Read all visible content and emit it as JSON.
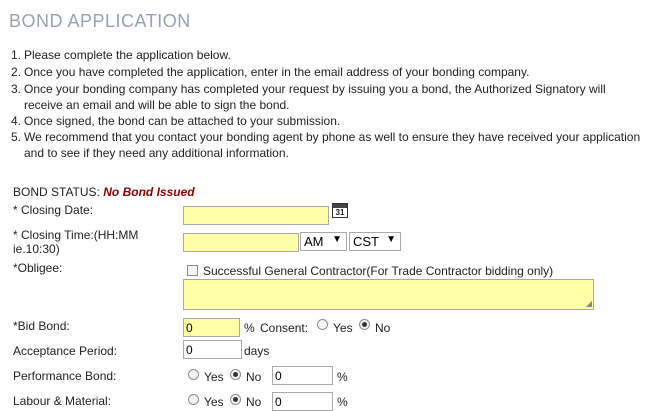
{
  "page": {
    "title": "BOND APPLICATION"
  },
  "instructions": [
    {
      "num": "1.",
      "text": "Please complete the application below."
    },
    {
      "num": "2.",
      "text": "Once you have completed the application, enter in the email address of your bonding company."
    },
    {
      "num": "3.",
      "text": "Once your bonding company has completed your request by issuing you a bond, the Authorized Signatory will",
      "cont": "receive an email and will be able to sign the bond."
    },
    {
      "num": "4.",
      "text": "Once signed, the bond can be attached to your submission."
    },
    {
      "num": "5.",
      "text": "We recommend that you contact your bonding agent by phone as well to ensure they have received your application",
      "cont": "and to see if they need any additional information."
    }
  ],
  "status": {
    "label": "BOND STATUS:",
    "value": "No Bond Issued"
  },
  "closing_date": {
    "label": "* Closing Date:",
    "value": "",
    "calendar_number": "31"
  },
  "closing_time": {
    "label_line1": "* Closing Time:(HH:MM",
    "label_line2": "ie.10:30)",
    "value": "",
    "ampm": "AM",
    "timezone": "CST"
  },
  "obligee": {
    "label": "*Obligee:",
    "checkbox_label": "Successful General Contractor(For Trade Contractor bidding only)",
    "checked": false,
    "value": ""
  },
  "bid_bond": {
    "label": "*Bid Bond:",
    "value": "0",
    "percent": "%",
    "consent_label": "Consent:",
    "yes": "Yes",
    "no": "No"
  },
  "acceptance": {
    "label": "Acceptance Period:",
    "value": "0",
    "unit": "days"
  },
  "performance": {
    "label": "Performance Bond:",
    "yes": "Yes",
    "no": "No",
    "value": "0",
    "percent": "%"
  },
  "labour": {
    "label": "Labour & Material:",
    "yes": "Yes",
    "no": "No",
    "value": "0",
    "percent": "%"
  }
}
